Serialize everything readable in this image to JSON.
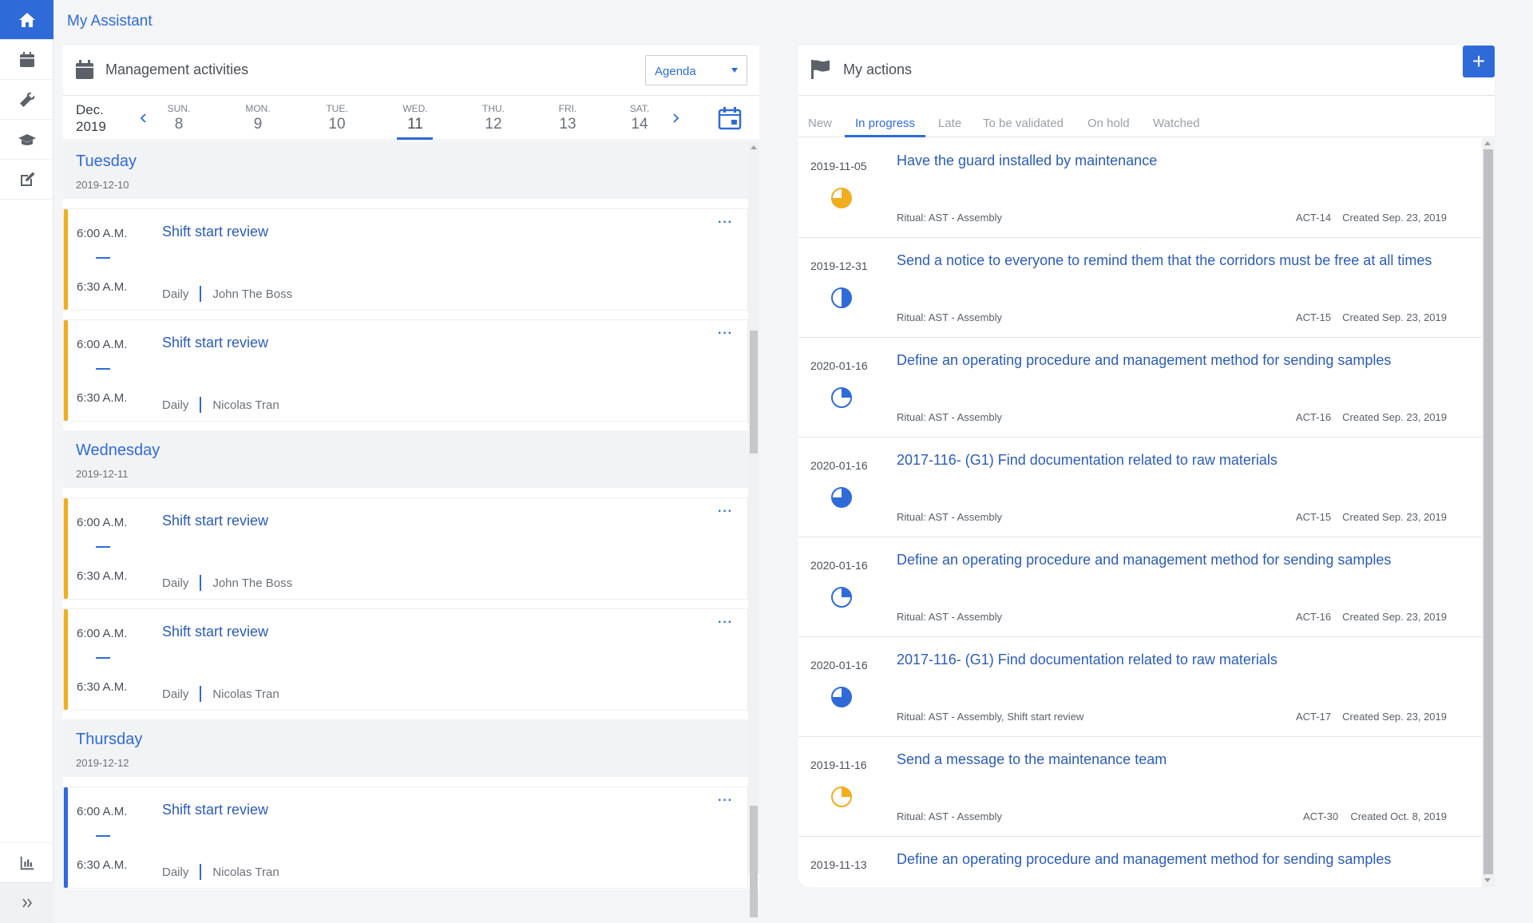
{
  "page": {
    "title": "My Assistant"
  },
  "colors": {
    "accent": "#2f6ad9",
    "event_orange": "#f0ad1e",
    "progress_orange": "#f0ad1e"
  },
  "sidebar": {
    "items": [
      {
        "icon": "home-icon",
        "active": true
      },
      {
        "icon": "calendar-icon"
      },
      {
        "icon": "wrench-icon"
      },
      {
        "icon": "graduation-cap-icon"
      },
      {
        "icon": "edit-icon"
      }
    ],
    "bottom": [
      {
        "icon": "bar-chart-icon"
      },
      {
        "icon": "expand-icon"
      }
    ]
  },
  "management": {
    "title": "Management activities",
    "view_select": "Agenda",
    "month": "Dec.",
    "year": "2019",
    "days": [
      {
        "name": "SUN.",
        "num": "8"
      },
      {
        "name": "MON.",
        "num": "9"
      },
      {
        "name": "TUE.",
        "num": "10"
      },
      {
        "name": "WED.",
        "num": "11",
        "selected": true
      },
      {
        "name": "THU.",
        "num": "12"
      },
      {
        "name": "FRI.",
        "num": "13"
      },
      {
        "name": "SAT.",
        "num": "14"
      }
    ],
    "groups": [
      {
        "day": "Tuesday",
        "date": "2019-12-10",
        "events": [
          {
            "start": "6:00 A.M.",
            "end": "6:30 A.M.",
            "title": "Shift start review",
            "frequency": "Daily",
            "owner": "John The Boss"
          },
          {
            "start": "6:00 A.M.",
            "end": "6:30 A.M.",
            "title": "Shift start review",
            "frequency": "Daily",
            "owner": "Nicolas Tran"
          }
        ]
      },
      {
        "day": "Wednesday",
        "date": "2019-12-11",
        "events": [
          {
            "start": "6:00 A.M.",
            "end": "6:30 A.M.",
            "title": "Shift start review",
            "frequency": "Daily",
            "owner": "John The Boss"
          },
          {
            "start": "6:00 A.M.",
            "end": "6:30 A.M.",
            "title": "Shift start review",
            "frequency": "Daily",
            "owner": "Nicolas Tran"
          }
        ]
      },
      {
        "day": "Thursday",
        "date": "2019-12-12",
        "events": [
          {
            "start": "6:00 A.M.",
            "end": "6:30 A.M.",
            "title": "Shift start review",
            "frequency": "Daily",
            "owner": "Nicolas Tran"
          }
        ]
      }
    ]
  },
  "actions": {
    "title": "My actions",
    "add_label": "+",
    "tabs": [
      "New",
      "In progress",
      "Late",
      "To be validated",
      "On hold",
      "Watched"
    ],
    "active_tab": "In progress",
    "items": [
      {
        "date": "2019-11-05",
        "title": "Have the guard installed by maintenance",
        "ritual": "Ritual: AST - Assembly",
        "id": "ACT-14",
        "created": "Created Sep. 23, 2019",
        "progress": 0.75,
        "progress_color": "#f0ad1e"
      },
      {
        "date": "2019-12-31",
        "title": "Send a notice to everyone to remind them that the corridors must be free at all times",
        "ritual": "Ritual: AST - Assembly",
        "id": "ACT-15",
        "created": "Created Sep. 23, 2019",
        "progress": 0.5,
        "progress_color": "#2f6ad9"
      },
      {
        "date": "2020-01-16",
        "title": "Define an operating procedure and management method for sending samples",
        "ritual": "Ritual: AST - Assembly",
        "id": "ACT-16",
        "created": "Created Sep. 23, 2019",
        "progress": 0.25,
        "progress_color": "#2f6ad9"
      },
      {
        "date": "2020-01-16",
        "title": "2017-116- (G1) Find documentation related to raw materials",
        "ritual": "Ritual: AST - Assembly",
        "id": "ACT-15",
        "created": "Created Sep. 23, 2019",
        "progress": 0.75,
        "progress_color": "#2f6ad9"
      },
      {
        "date": "2020-01-16",
        "title": "Define an operating procedure and management method for sending samples",
        "ritual": "Ritual: AST - Assembly",
        "id": "ACT-16",
        "created": "Created Sep. 23, 2019",
        "progress": 0.25,
        "progress_color": "#2f6ad9"
      },
      {
        "date": "2020-01-16",
        "title": "2017-116- (G1) Find documentation related to raw materials",
        "ritual": "Ritual: AST - Assembly, Shift start review",
        "id": "ACT-17",
        "created": "Created Sep. 23, 2019",
        "progress": 0.75,
        "progress_color": "#2f6ad9"
      },
      {
        "date": "2019-11-16",
        "title": "Send a message to the maintenance team",
        "ritual": "Ritual: AST - Assembly",
        "id": "ACT-30",
        "created": "Created Oct. 8, 2019",
        "progress": 0.25,
        "progress_color": "#f0ad1e"
      },
      {
        "date": "2019-11-13",
        "title": "Define an operating procedure and management method for sending samples",
        "ritual": "",
        "id": "",
        "created": "",
        "progress": 0,
        "progress_color": "#2f6ad9"
      }
    ]
  }
}
